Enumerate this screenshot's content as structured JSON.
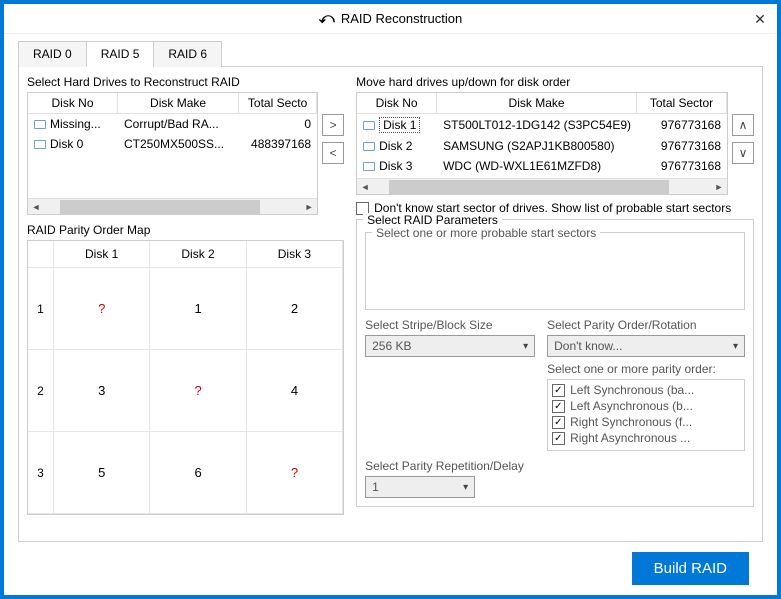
{
  "title": "RAID Reconstruction",
  "tabs": [
    "RAID 0",
    "RAID 5",
    "RAID 6"
  ],
  "left": {
    "label": "Select Hard Drives to Reconstruct RAID",
    "headers": [
      "Disk No",
      "Disk Make",
      "Total Secto"
    ],
    "rows": [
      {
        "no": "Missing...",
        "make": "Corrupt/Bad RA...",
        "sec": "0"
      },
      {
        "no": "Disk 0",
        "make": "CT250MX500SS...",
        "sec": "488397168"
      }
    ]
  },
  "parityMap": {
    "label": "RAID Parity Order Map",
    "cols": [
      "Disk 1",
      "Disk 2",
      "Disk 3"
    ],
    "rows": [
      {
        "n": "1",
        "c": [
          "?",
          "1",
          "2"
        ]
      },
      {
        "n": "2",
        "c": [
          "3",
          "?",
          "4"
        ]
      },
      {
        "n": "3",
        "c": [
          "5",
          "6",
          "?"
        ]
      }
    ]
  },
  "right": {
    "label": "Move hard drives up/down for disk order",
    "headers": [
      "Disk No",
      "Disk Make",
      "Total Sector"
    ],
    "rows": [
      {
        "no": "Disk 1",
        "make": "ST500LT012-1DG142 (S3PC54E9)",
        "sec": "976773168",
        "sel": true
      },
      {
        "no": "Disk 2",
        "make": "SAMSUNG (S2APJ1KB800580)",
        "sec": "976773168"
      },
      {
        "no": "Disk 3",
        "make": "WDC (WD-WXL1E61MZFD8)",
        "sec": "976773168"
      }
    ],
    "dontKnow": "Don't know start sector of drives. Show list of probable start sectors",
    "params": {
      "title": "Select RAID Parameters",
      "startSectors": "Select one or more probable start sectors",
      "stripeLabel": "Select Stripe/Block Size",
      "stripeValue": "256 KB",
      "parityLabel": "Select Parity Order/Rotation",
      "parityValue": "Don't know...",
      "parityListLabel": "Select one or more parity order:",
      "parityList": [
        "Left Synchronous (ba...",
        "Left Asynchronous (b...",
        "Right Synchronous (f...",
        "Right Asynchronous ..."
      ],
      "repLabel": "Select Parity Repetition/Delay",
      "repValue": "1"
    }
  },
  "buildBtn": "Build RAID"
}
